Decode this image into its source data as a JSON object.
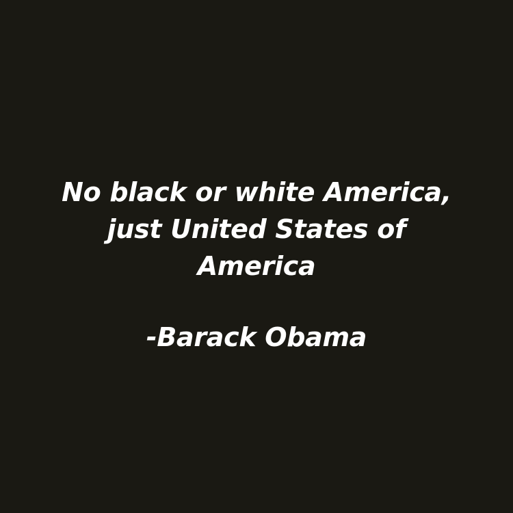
{
  "quote": {
    "lines": [
      "No black or white America,",
      "just United States of",
      "America"
    ],
    "attribution": "-Barack Obama"
  },
  "colors": {
    "background": "#1a1913",
    "text": "#ffffff"
  }
}
